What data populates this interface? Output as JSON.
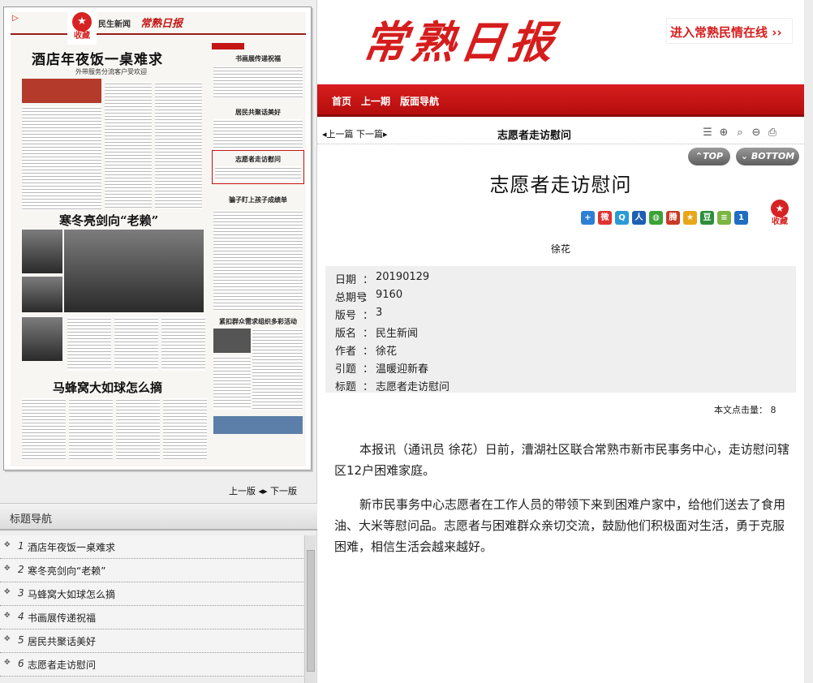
{
  "masthead": {
    "logo_text": "常熟日报",
    "enter_link": "进入常熟民情在线 ››"
  },
  "topnav": {
    "home": "首页",
    "prev_issue": "上一期",
    "layout_nav": "版面导航"
  },
  "paper_thumb": {
    "fav_label": "收藏",
    "section": "民生新闻",
    "brand": "常熟日报",
    "headline1": "酒店年夜饭一桌难求",
    "headline1_sub": "外带服务分流客户受欢迎",
    "headline2": "寒冬亮剑向“老赖”",
    "headline3": "马蜂窝大如球怎么摘",
    "right_titles": [
      "书画展传递祝福",
      "居民共聚话美好",
      "志愿者走访慰问",
      "骗子盯上孩子成绩单",
      "紧扣群众需求组织多彩活动"
    ]
  },
  "pager": {
    "prev": "上一版",
    "next": "下一版"
  },
  "title_nav": {
    "header": "标题导航",
    "items": [
      {
        "num": "1",
        "title": "酒店年夜饭一桌难求"
      },
      {
        "num": "2",
        "title": "寒冬亮剑向“老赖”"
      },
      {
        "num": "3",
        "title": "马蜂窝大如球怎么摘"
      },
      {
        "num": "4",
        "title": "书画展传递祝福"
      },
      {
        "num": "5",
        "title": "居民共聚话美好"
      },
      {
        "num": "6",
        "title": "志愿者走访慰问"
      }
    ]
  },
  "subbar": {
    "prev_article": "上一篇",
    "next_article": "下一篇",
    "title": "志愿者走访慰问"
  },
  "buttons": {
    "top": "TOP",
    "bottom": "BOTTOM",
    "fav": "收藏"
  },
  "article": {
    "title": "志愿者走访慰问",
    "author": "徐花",
    "meta": [
      {
        "key": "日期",
        "value": "20190129"
      },
      {
        "key": "总期号",
        "value": "9160"
      },
      {
        "key": "版号",
        "value": "3"
      },
      {
        "key": "版名",
        "value": "民生新闻"
      },
      {
        "key": "作者",
        "value": "徐花"
      },
      {
        "key": "引题",
        "value": "温暖迎新春"
      },
      {
        "key": "标题",
        "value": "志愿者走访慰问"
      }
    ],
    "hits_label": "本文点击量：",
    "hits_value": "8",
    "paragraphs": [
      "本报讯（通讯员 徐花）日前，漕湖社区联合常熟市新市民事务中心，走访慰问辖区12户困难家庭。",
      "新市民事务中心志愿者在工作人员的带领下来到困难户家中，给他们送去了食用油、大米等慰问品。志愿者与困难群众亲切交流，鼓励他们积极面对生活，勇于克服困难，相信生活会越来越好。"
    ]
  },
  "colors": {
    "brand_red": "#d61d1d",
    "meta_bg": "#efefef"
  }
}
